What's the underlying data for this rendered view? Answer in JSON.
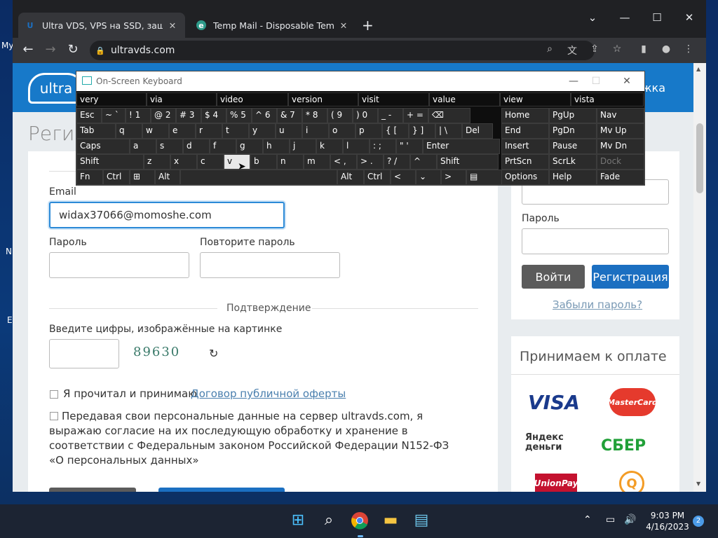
{
  "desktop": {
    "icon_labels": [
      "My",
      "N",
      "E"
    ]
  },
  "browser": {
    "tabs": [
      {
        "label": "Ultra VDS, VPS на SSD, защита о",
        "favicon": "U",
        "active": true
      },
      {
        "label": "Temp Mail - Disposable Tempora",
        "favicon": "e",
        "active": false
      }
    ],
    "url": "ultravds.com",
    "window_buttons": {
      "chevron": "⌄",
      "minimize": "—",
      "maximize": "☐",
      "close": "✕"
    }
  },
  "site": {
    "logo": "ultra",
    "header_right": "жка",
    "title": "Регис",
    "form": {
      "email_label": "Email",
      "email_value": "widax37066@momoshe.com",
      "password_label": "Пароль",
      "repeat_label": "Повторите пароль",
      "confirm_heading": "Подтверждение",
      "captcha_label": "Введите цифры, изображённые на картинке",
      "captcha_text": "89630",
      "agree1_text": "Я прочитал и принимаю",
      "agree1_link": "Договор публичной оферты",
      "agree2_text": "Передавая свои персональные данные на сервер ultravds.com, я выражаю согласие на их последующую обработку и хранение в соответствии с Федеральным законом Российской Федерации N152-ФЗ «О персональных данных»"
    },
    "login": {
      "password_label": "Пароль",
      "login_button": "Войти",
      "register_button": "Регистрация",
      "forgot_link": "Забыли пароль?"
    },
    "payment": {
      "heading": "Принимаем к оплате",
      "logos": [
        "VISA",
        "MasterCard",
        "Яндекс деньги",
        "СБЕР",
        "UnionPay",
        "Q"
      ]
    }
  },
  "osk": {
    "title": "On-Screen Keyboard",
    "suggestions": [
      "very",
      "via",
      "video",
      "version",
      "visit",
      "value",
      "view",
      "vista"
    ],
    "rows": [
      [
        "Esc",
        "~ `",
        "! 1",
        "@ 2",
        "# 3",
        "$ 4",
        "% 5",
        "^ 6",
        "& 7",
        "* 8",
        "( 9",
        ") 0",
        "_ -",
        "+ =",
        "⌫"
      ],
      [
        "Tab",
        "q",
        "w",
        "e",
        "r",
        "t",
        "y",
        "u",
        "i",
        "o",
        "p",
        "{ [",
        "} ]",
        "| \\",
        "Del"
      ],
      [
        "Caps",
        "a",
        "s",
        "d",
        "f",
        "g",
        "h",
        "j",
        "k",
        "l",
        ": ;",
        "\" '",
        "Enter"
      ],
      [
        "Shift",
        "z",
        "x",
        "c",
        "v",
        "b",
        "n",
        "m",
        "< ,",
        "> .",
        "? /",
        "^",
        "Shift"
      ],
      [
        "Fn",
        "Ctrl",
        "⊞",
        "Alt",
        "",
        "Alt",
        "Ctrl",
        "<",
        "⌄",
        ">",
        "▤"
      ]
    ],
    "nav_keys": [
      [
        "Home",
        "PgUp",
        "Nav"
      ],
      [
        "End",
        "PgDn",
        "Mv Up"
      ],
      [
        "Insert",
        "Pause",
        "Mv Dn"
      ],
      [
        "PrtScn",
        "ScrLk",
        "Dock"
      ],
      [
        "Options",
        "Help",
        "Fade"
      ]
    ],
    "pressed_key": "v"
  },
  "taskbar": {
    "time": "9:03 PM",
    "date": "4/16/2023",
    "notification_count": "2"
  }
}
